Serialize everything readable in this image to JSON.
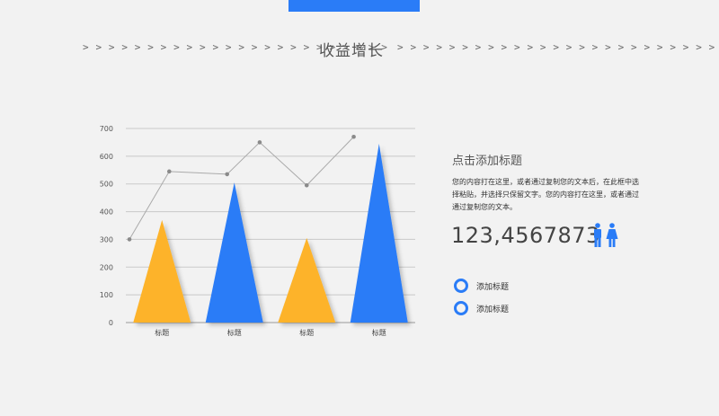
{
  "header": {
    "title": "收益增长",
    "left_arrows": "> > > > > > > > > > > > > > > > > > > > > > > >",
    "right_arrows": "> > > > > > > > > > > > > > > > > > > > > > > > >"
  },
  "chart_data": {
    "type": "bar",
    "shape": "triangle",
    "categories": [
      "标题",
      "标题",
      "标题",
      "标题"
    ],
    "bars": [
      {
        "value": 370,
        "color": "#fdb32a"
      },
      {
        "value": 505,
        "color": "#2a7cf7"
      },
      {
        "value": 305,
        "color": "#fdb32a"
      },
      {
        "value": 645,
        "color": "#2a7cf7"
      }
    ],
    "line": {
      "color": "#aaaaaa",
      "points": [
        [
          0.05,
          300
        ],
        [
          0.6,
          545
        ],
        [
          1.4,
          535
        ],
        [
          1.85,
          650
        ],
        [
          2.5,
          495
        ],
        [
          3.15,
          670
        ]
      ]
    },
    "yticks": [
      0,
      100,
      200,
      300,
      400,
      500,
      600,
      700
    ],
    "ylim": [
      0,
      700
    ],
    "grid": true
  },
  "panel": {
    "title": "点击添加标题",
    "description": "您的内容打在这里，或者通过复制您的文本后，在此框中选择粘贴，并选择只保留文字。您的内容打在这里，或者通过通过复制您的文本。",
    "big_number": "123,4567873",
    "icon_color": "#2a7cf7"
  },
  "legend": [
    {
      "label": "添加标题"
    },
    {
      "label": "添加标题"
    }
  ],
  "icons": [
    "male-person-icon",
    "female-person-icon",
    "ring-bullet-icon"
  ]
}
